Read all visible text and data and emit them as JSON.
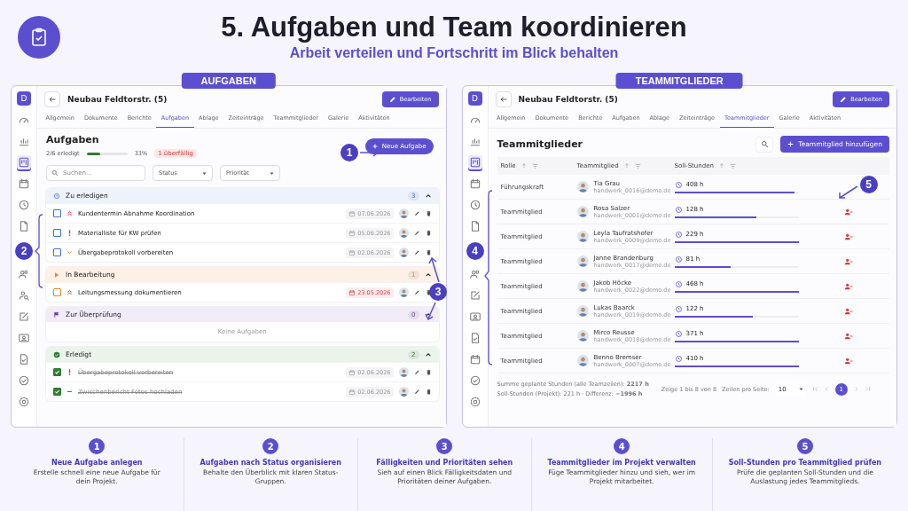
{
  "header": {
    "title": "5. Aufgaben und Team koordinieren",
    "subtitle": "Arbeit verteilen und Fortschritt im Blick behalten"
  },
  "tasks_panel": {
    "label": "AUFGABEN",
    "avatar": "D",
    "project_title": "Neubau Feldtorstr. (5)",
    "edit_button": "Bearbeiten",
    "nav": [
      {
        "kind": "gauge",
        "selected": false
      },
      {
        "kind": "chart",
        "selected": false
      },
      {
        "kind": "board",
        "selected": true
      },
      {
        "kind": "calendar",
        "selected": false
      },
      {
        "kind": "clock",
        "selected": false
      },
      {
        "kind": "file",
        "selected": false
      },
      {
        "kind": "users",
        "selected": false
      },
      {
        "kind": "user-search",
        "selected": false
      },
      {
        "kind": "edit",
        "selected": false
      },
      {
        "kind": "id-card",
        "selected": false
      },
      {
        "kind": "file-check",
        "selected": false
      },
      {
        "kind": "check",
        "selected": false
      },
      {
        "kind": "gear",
        "selected": false
      }
    ],
    "tabs": [
      {
        "label": "Allgemein",
        "selected": false
      },
      {
        "label": "Dokumente",
        "selected": false
      },
      {
        "label": "Berichte",
        "selected": false
      },
      {
        "label": "Aufgaben",
        "selected": true
      },
      {
        "label": "Ablage",
        "selected": false
      },
      {
        "label": "Zeiteinträge",
        "selected": false
      },
      {
        "label": "Teammitglieder",
        "selected": false
      },
      {
        "label": "Galerie",
        "selected": false
      },
      {
        "label": "Aktivitäten",
        "selected": false
      }
    ],
    "heading": "Aufgaben",
    "progress": {
      "text": "2/6 erledigt",
      "level": 0.33,
      "percent": "33%",
      "overdue": "1 überfällig"
    },
    "new_button": "Neue Aufgabe",
    "search": {
      "placeholder": "Suchen..."
    },
    "filters": [
      "Status",
      "Priorität"
    ],
    "groups": [
      {
        "kind": "todo",
        "title": "Zu erledigen",
        "count": "3",
        "expanded": true,
        "tasks": [
          {
            "title": "Kundentermin Abnahme Koordination",
            "kind": "urgent",
            "done": false,
            "date": "07.06.2026",
            "overdue": false
          },
          {
            "title": "Materialliste für KW prüfen",
            "kind": "high",
            "done": false,
            "date": "05.06.2026",
            "overdue": false
          },
          {
            "title": "Übergabeprotokoll vorbereiten",
            "kind": "low",
            "done": false,
            "date": "02.06.2026",
            "overdue": false
          }
        ]
      },
      {
        "kind": "progress",
        "title": "In Bearbeitung",
        "count": "1",
        "expanded": true,
        "tasks": [
          {
            "title": "Leitungsmessung dokumentieren",
            "kind": "urgent",
            "done": false,
            "date": "23.05.2026",
            "overdue": true
          }
        ]
      },
      {
        "kind": "review",
        "title": "Zur Überprüfung",
        "count": "0",
        "expanded": true,
        "empty": "Keine Aufgaben"
      },
      {
        "kind": "done",
        "title": "Erledigt",
        "count": "2",
        "expanded": true,
        "tasks": [
          {
            "title": "Übergabeprotokoll vorbereiten",
            "kind": "high",
            "done": true,
            "date": "02.06.2026",
            "overdue": false
          },
          {
            "title": "Zwischenbericht Fotos hochladen",
            "kind": "medium",
            "done": true,
            "date": "02.06.2026",
            "overdue": false
          }
        ]
      }
    ],
    "markers": [
      "1",
      "2",
      "3"
    ]
  },
  "team_panel": {
    "label": "TEAMMITGLIEDER",
    "avatar": "D",
    "project_title": "Neubau Feldtorstr. (5)",
    "edit_button": "Bearbeiten",
    "nav": [
      {
        "kind": "gauge",
        "selected": false
      },
      {
        "kind": "chart",
        "selected": false
      },
      {
        "kind": "board",
        "selected": true
      },
      {
        "kind": "calendar",
        "selected": false
      },
      {
        "kind": "clock",
        "selected": false
      },
      {
        "kind": "file",
        "selected": false
      },
      {
        "kind": "users",
        "selected": false
      },
      {
        "kind": "edit",
        "selected": false
      },
      {
        "kind": "id-card",
        "selected": false
      },
      {
        "kind": "file-check",
        "selected": false
      },
      {
        "kind": "calendar",
        "selected": false
      },
      {
        "kind": "check",
        "selected": false
      },
      {
        "kind": "gear",
        "selected": false
      }
    ],
    "tabs": [
      {
        "label": "Allgemein",
        "selected": false
      },
      {
        "label": "Dokumente",
        "selected": false
      },
      {
        "label": "Berichte",
        "selected": false
      },
      {
        "label": "Aufgaben",
        "selected": false
      },
      {
        "label": "Ablage",
        "selected": false
      },
      {
        "label": "Zeiteinträge",
        "selected": false
      },
      {
        "label": "Teammitglieder",
        "selected": true
      },
      {
        "label": "Galerie",
        "selected": false
      },
      {
        "label": "Aktivitäten",
        "selected": false
      }
    ],
    "heading": "Teammitglieder",
    "add_button": "Teammitglied hinzufügen",
    "columns": [
      "Rolle",
      "Teammitglied",
      "Soll-Stunden"
    ],
    "rows": [
      {
        "role": "Führungskraft",
        "name": "Tia Grau",
        "email": "handwerk_0016@demo.de",
        "hours": "408 h",
        "level": 0.97,
        "removable": false
      },
      {
        "role": "Teammitglied",
        "name": "Rosa Salzer",
        "email": "handwerk_0001@demo.de",
        "hours": "128 h",
        "level": 0.66,
        "removable": true
      },
      {
        "role": "Teammitglied",
        "name": "Leyla Taufratshofer",
        "email": "handwerk_0009@demo.de",
        "hours": "229 h",
        "level": 1,
        "removable": true
      },
      {
        "role": "Teammitglied",
        "name": "Janne Brandenburg",
        "email": "handwerk_0017@demo.de",
        "hours": "81 h",
        "level": 0.45,
        "removable": true
      },
      {
        "role": "Teammitglied",
        "name": "Jakob Höcke",
        "email": "handwerk_0022@demo.de",
        "hours": "468 h",
        "level": 1,
        "removable": true
      },
      {
        "role": "Teammitglied",
        "name": "Lukas Baarck",
        "email": "handwerk_0019@demo.de",
        "hours": "122 h",
        "level": 0.63,
        "removable": true
      },
      {
        "role": "Teammitglied",
        "name": "Mirco Reusse",
        "email": "handwerk_0018@demo.de",
        "hours": "371 h",
        "level": 1,
        "removable": true
      },
      {
        "role": "Teammitglied",
        "name": "Benno Bremser",
        "email": "handwerk_0007@demo.de",
        "hours": "410 h",
        "level": 1,
        "removable": true
      }
    ],
    "summary": [
      "Summe geplante Stunden (alle Teamzeilen): **2217 h**",
      "Soll-Stunden (Projekt): 221 h · Differenz: **−1996 h**"
    ],
    "page_info": "Zeige 1 bis 8 von 8",
    "rows_per_page_label": "Zeilen pro Seite:",
    "rows_per_page": "10",
    "pages": [
      {
        "label": "1",
        "selected": true
      }
    ],
    "markers": [
      "4",
      "5"
    ]
  },
  "steps": [
    {
      "number": "1",
      "title": "Neue Aufgabe anlegen",
      "text": "Erstelle schnell eine neue Aufgabe für dein Projekt."
    },
    {
      "number": "2",
      "title": "Aufgaben nach Status organisieren",
      "text": "Behalte den Überblick mit klaren Status-Gruppen."
    },
    {
      "number": "3",
      "title": "Fälligkeiten und Prioritäten sehen",
      "text": "Sieh auf einen Blick Fälligkeitsdaten und Prioritäten deiner Aufgaben."
    },
    {
      "number": "4",
      "title": "Teammitglieder im Projekt verwalten",
      "text": "Füge Teammitglieder hinzu und sieh, wer im Projekt mitarbeitet."
    },
    {
      "number": "5",
      "title": "Soll-Stunden pro Teammitglied prüfen",
      "text": "Prüfe die geplanten Soll-Stunden und die Auslastung jedes Teammitglieds."
    }
  ]
}
